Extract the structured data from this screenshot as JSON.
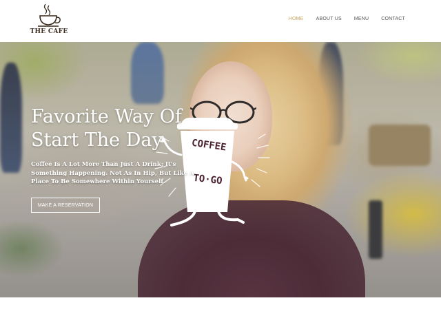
{
  "brand": {
    "name": "THE CAFE",
    "logo_icon": "coffee-cup-icon"
  },
  "nav": {
    "items": [
      {
        "label": "HOME",
        "active": true
      },
      {
        "label": "ABOUT US",
        "active": false
      },
      {
        "label": "MENU",
        "active": false
      },
      {
        "label": "CONTACT",
        "active": false
      }
    ]
  },
  "hero": {
    "title_line1": "Favorite Way  Of",
    "title_line2": "Start The Day",
    "description": "Coffee Is A Lot More Than Just A Drink; It's Something Happening. Not As In Hip, But Like A Place To Be Somewhere Within Yourself.",
    "cta_label": "MAKE A RESERVATION",
    "illustration_text_line1": "COFFEE",
    "illustration_text_line2": "TO·GO"
  },
  "colors": {
    "accent": "#c9a25a",
    "nav_text": "#555555",
    "hero_text": "#ffffff",
    "logo_text": "#3a2a1c"
  }
}
